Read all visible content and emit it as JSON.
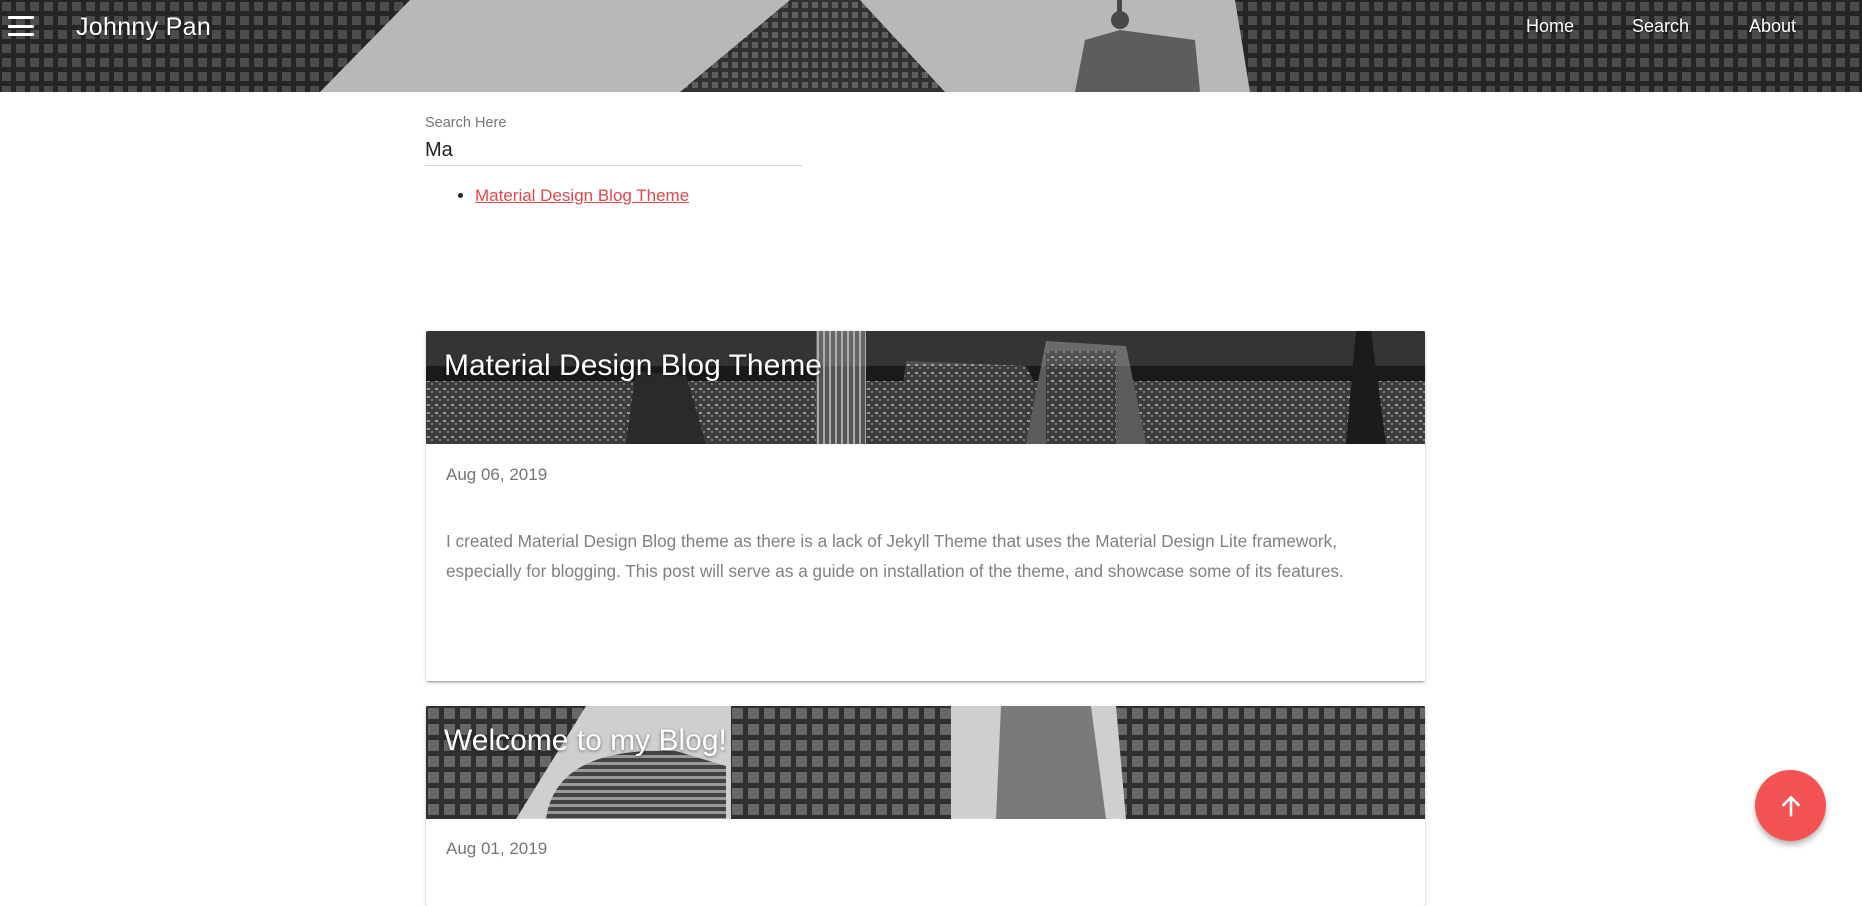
{
  "header": {
    "site_title": "Johnny Pan",
    "menu_icon": "hamburger-menu-icon",
    "nav": [
      {
        "label": "Home"
      },
      {
        "label": "Search"
      },
      {
        "label": "About"
      }
    ]
  },
  "search": {
    "label": "Search Here",
    "value": "Ma",
    "results": [
      {
        "label": "Material Design Blog Theme"
      }
    ]
  },
  "posts": [
    {
      "title": "Material Design Blog Theme",
      "date": "Aug 06, 2019",
      "excerpt": "I created Material Design Blog theme as there is a lack of Jekyll Theme that uses the Material Design Lite framework, especially for blogging. This post will serve as a guide on installation of the theme, and showcase some of its features."
    },
    {
      "title": "Welcome to my Blog!",
      "date": "Aug 01, 2019"
    }
  ],
  "fab": {
    "icon": "arrow-up-icon",
    "color": "#f35353"
  },
  "colors": {
    "link": "#e0474c",
    "text_muted": "#757575"
  }
}
